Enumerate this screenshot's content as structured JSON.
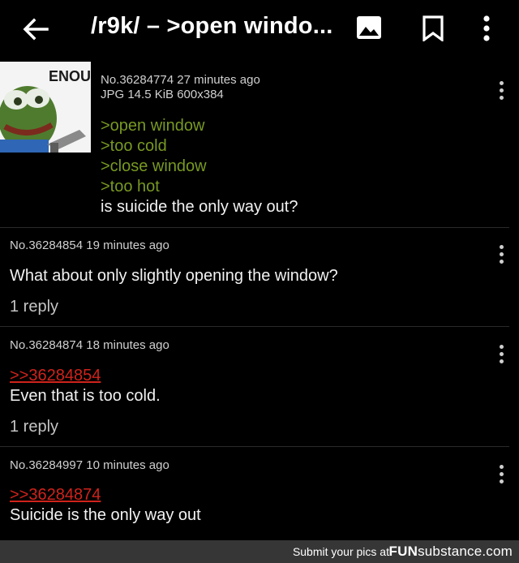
{
  "appbar": {
    "title": "/r9k/ – >open windo..."
  },
  "op": {
    "post_no": "No.36284774",
    "time": "27 minutes ago",
    "file_info": "JPG 14.5 KiB 600x384",
    "thumb_text": "ENOU",
    "lines": [
      ">open window",
      ">too cold",
      ">close window",
      ">too hot"
    ],
    "text": "is suicide the only way out?"
  },
  "replies": [
    {
      "post_no": "No.36284854",
      "time": "19 minutes ago",
      "text": "What about only slightly opening the window?",
      "reply_count": "1 reply"
    },
    {
      "post_no": "No.36284874",
      "time": "18 minutes ago",
      "quote": ">>36284854",
      "text": "Even that is too cold.",
      "reply_count": "1 reply"
    },
    {
      "post_no": "No.36284997",
      "time": "10 minutes ago",
      "quote": ">>36284874",
      "text": "Suicide is the only way out"
    }
  ],
  "footer": {
    "cta": "Submit your pics at",
    "brand_bold": "FUN",
    "brand_rest": "substance",
    "brand_tld": ".com"
  }
}
